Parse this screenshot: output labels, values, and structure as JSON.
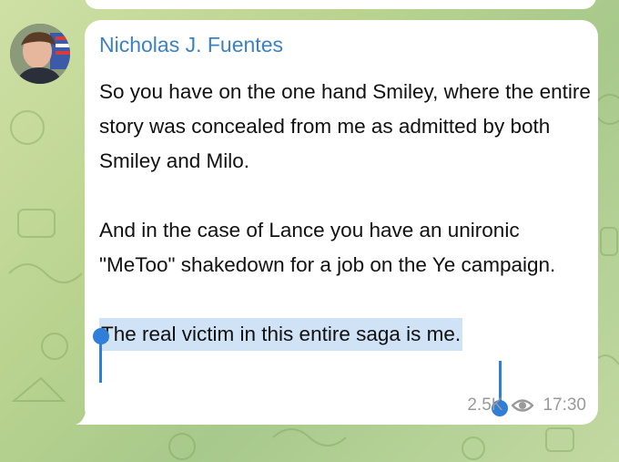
{
  "post": {
    "sender": "Nicholas J. Fuentes",
    "paragraph_1": "So you have on the one hand Smiley, where the entire story was concealed from me as admitted by both Smiley and Milo.",
    "paragraph_2": "And in the case of Lance you have an unironic \"MeToo\" shakedown for a job on the Ye campaign.",
    "selected_text": "The real victim in this entire saga is me.",
    "views": "2.5K",
    "time": "17:30"
  },
  "icons": {
    "views": "eye-icon",
    "selection_start": "selection-handle-start-icon",
    "selection_end": "selection-handle-end-icon"
  },
  "colors": {
    "sender_name": "#3a82c4",
    "selection": "#cfe2f6",
    "selection_handle": "#2f7fd8",
    "bubble": "#ffffff",
    "meta": "#9a9a9a"
  }
}
